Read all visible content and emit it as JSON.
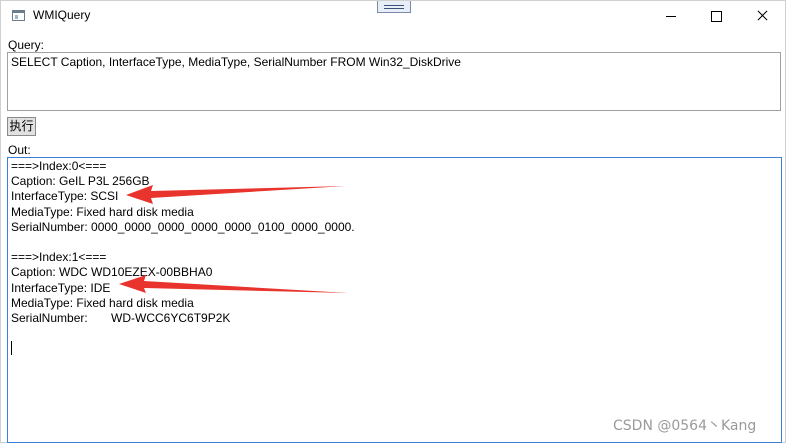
{
  "window": {
    "title": "WMIQuery"
  },
  "query": {
    "label": "Query:",
    "value": "SELECT Caption, InterfaceType, MediaType, SerialNumber FROM Win32_DiskDrive"
  },
  "execute_button": {
    "label": "执行"
  },
  "output": {
    "label": "Out:",
    "lines": [
      "===>Index:0<===",
      "Caption: GeIL P3L 256GB",
      "InterfaceType: SCSI",
      "MediaType: Fixed hard disk media",
      "SerialNumber: 0000_0000_0000_0000_0000_0100_0000_0000.",
      "",
      "===>Index:1<===",
      "Caption: WDC WD10EZEX-00BBHA0",
      "InterfaceType: IDE",
      "MediaType: Fixed hard disk media",
      "SerialNumber:       WD-WCC6YC6T9P2K"
    ]
  },
  "watermark": "CSDN @0564丶Kang",
  "colors": {
    "annotation_arrow": "#e8342c",
    "focus_border": "#3c7fd6"
  },
  "icons": {
    "app": "window-app-icon",
    "minimize": "minimize-icon",
    "maximize": "maximize-icon",
    "close": "close-icon"
  }
}
